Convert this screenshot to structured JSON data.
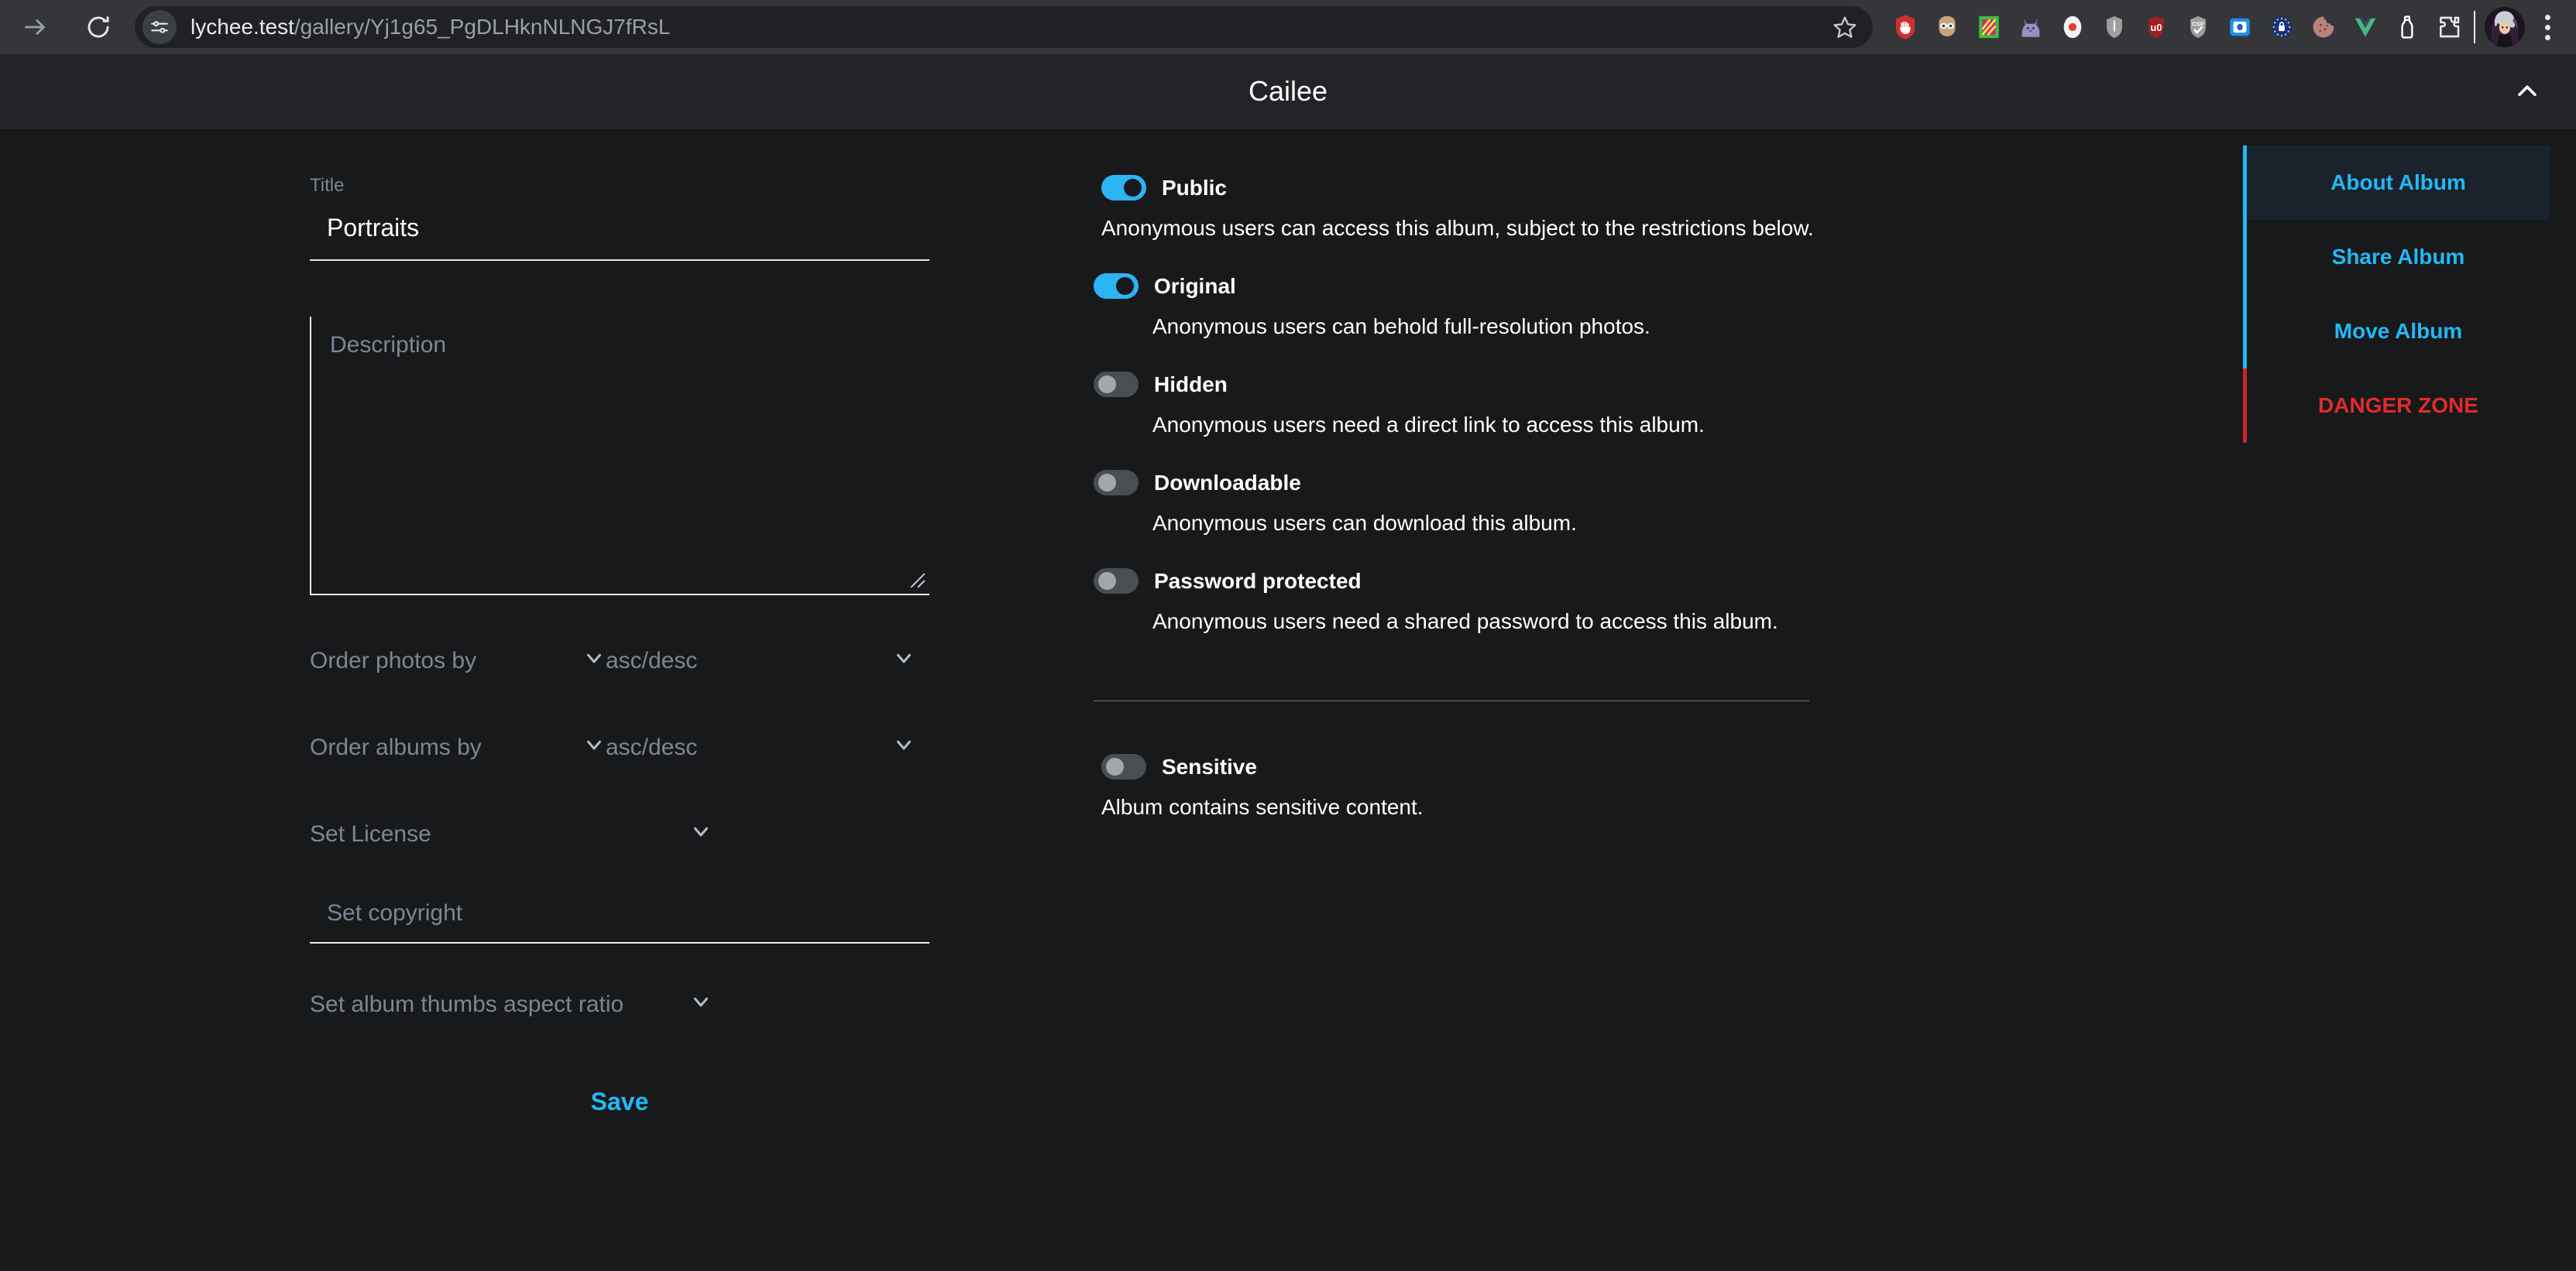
{
  "browser": {
    "forward_icon": "arrow-forward-icon",
    "reload_icon": "reload-icon",
    "site_settings_icon": "tune-icon",
    "url_host": "lychee.test",
    "url_path": "/gallery/Yj1g65_PgDLHknNLNGJ7fRsL",
    "url_full": "lychee.test/gallery/Yj1g65_PgDLHknNLNGJ7fRsL",
    "bookmark_icon": "star-outline-icon",
    "extensions": [
      {
        "name": "ublock-origin-stop-icon",
        "color": "#d32f2f"
      },
      {
        "name": "face-mask-icon",
        "color": "#c9a27e"
      },
      {
        "name": "colorful-square-icon",
        "color": "#3bbf3b"
      },
      {
        "name": "purple-cat-icon",
        "color": "#9a8ec4"
      },
      {
        "name": "red-dot-record-icon",
        "color": "#e53935"
      },
      {
        "name": "grey-shield-icon",
        "color": "#9e9e9e"
      },
      {
        "name": "ublock-shield-icon",
        "color": "#a02020"
      },
      {
        "name": "csp-shield-icon",
        "color": "#9e9e9e"
      },
      {
        "name": "blue-square-icon",
        "color": "#1d8ff0"
      },
      {
        "name": "eu-lock-icon",
        "color": "#1a3a8f"
      },
      {
        "name": "cookie-icon",
        "color": "#b9827a"
      },
      {
        "name": "vue-devtools-icon",
        "color": "#42b883"
      },
      {
        "name": "bottle-icon",
        "color": "#ffffff"
      }
    ],
    "extensions_puzzle_icon": "puzzle-icon",
    "avatar_icon": "profile-avatar",
    "menu_icon": "three-dot-menu-icon"
  },
  "header": {
    "title": "Cailee",
    "collapse_icon": "chevron-up-icon"
  },
  "form": {
    "title_label": "Title",
    "title_value": "Portraits",
    "title_placeholder": "Title",
    "description_value": "",
    "description_placeholder": "Description",
    "order_photos_label": "Order photos by",
    "order_photos_dir": "asc/desc",
    "order_albums_label": "Order albums by",
    "order_albums_dir": "asc/desc",
    "license_label": "Set License",
    "copyright_placeholder": "Set copyright",
    "copyright_value": "",
    "aspect_ratio_label": "Set album thumbs aspect ratio",
    "save_label": "Save",
    "chevron_icon": "chevron-down-icon"
  },
  "toggles": {
    "public": {
      "label": "Public",
      "description": "Anonymous users can access this album, subject to the restrictions below.",
      "on": true
    },
    "original": {
      "label": "Original",
      "description": "Anonymous users can behold full-resolution photos.",
      "on": true
    },
    "hidden": {
      "label": "Hidden",
      "description": "Anonymous users need a direct link to access this album.",
      "on": false
    },
    "downloadable": {
      "label": "Downloadable",
      "description": "Anonymous users can download this album.",
      "on": false
    },
    "password_protected": {
      "label": "Password protected",
      "description": "Anonymous users need a shared password to access this album.",
      "on": false
    },
    "sensitive": {
      "label": "Sensitive",
      "description": "Album contains sensitive content.",
      "on": false
    }
  },
  "sidebar": {
    "items": [
      {
        "label": "About Album",
        "active": true,
        "danger": false
      },
      {
        "label": "Share Album",
        "active": false,
        "danger": false
      },
      {
        "label": "Move Album",
        "active": false,
        "danger": false
      },
      {
        "label": "DANGER ZONE",
        "active": false,
        "danger": true
      }
    ]
  },
  "colors": {
    "accent": "#22b9f5",
    "toggle_on": "#2cb4f5",
    "danger": "#e02b2b",
    "page_bg": "#18191b",
    "header_bg": "#232427",
    "muted_text": "#7d8794"
  }
}
